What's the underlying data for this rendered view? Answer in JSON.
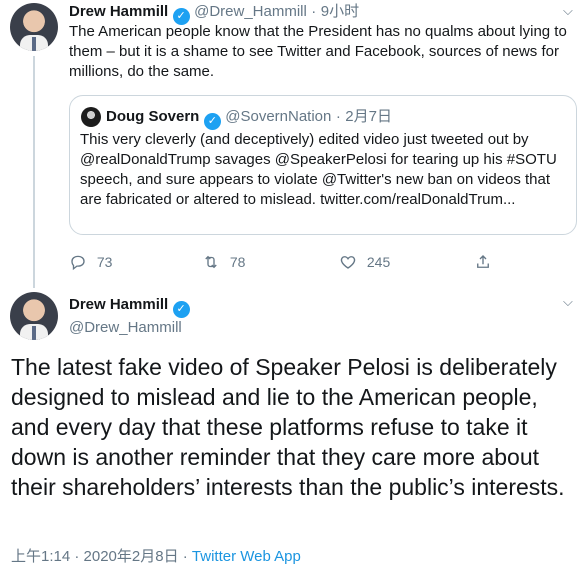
{
  "tweet1": {
    "name": "Drew Hammill",
    "handle": "@Drew_Hammill",
    "separator": "·",
    "time": "9小时",
    "text": "The American people know that the President has no qualms about lying to them – but it is a shame to see Twitter and Facebook, sources of news for millions, do the same.",
    "quote": {
      "name": "Doug Sovern",
      "handle": "@SovernNation",
      "separator": "·",
      "date": "2月7日",
      "text": "This very cleverly (and deceptively) edited video just tweeted out by @realDonaldTrump savages @SpeakerPelosi for tearing up his #SOTU speech, and sure appears to violate @Twitter's new ban on videos that are fabricated or altered to mislead. twitter.com/realDonaldTrum..."
    },
    "actions": {
      "replies": "73",
      "retweets": "78",
      "likes": "245"
    }
  },
  "tweet2": {
    "name": "Drew Hammill",
    "handle": "@Drew_Hammill",
    "text": "The latest fake video of Speaker Pelosi is deliberately designed to mislead and lie to the American people, and every day that these platforms refuse to take it down is another reminder that they care more about their shareholders’ interests than the public’s interests.",
    "timestamp": "上午1:14 · 2020年2月8日 · ",
    "app": "Twitter Web App"
  },
  "icons": {
    "verified": "✓",
    "caret": "⌵"
  },
  "colors": {
    "accent": "#1da1f2",
    "link": "#1b95e0",
    "secondary_text": "#657786",
    "border": "#ccd6dd"
  }
}
